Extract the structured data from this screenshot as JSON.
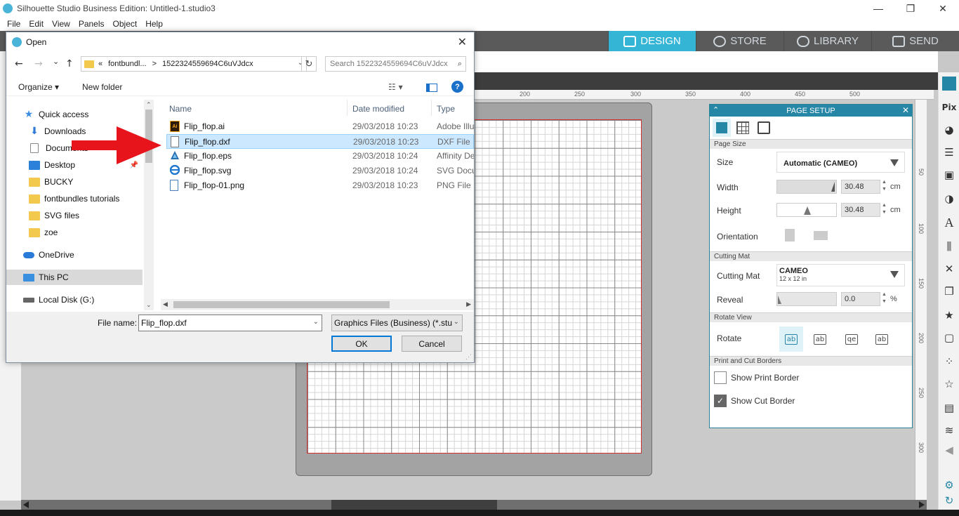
{
  "window": {
    "title": "Silhouette Studio Business Edition: Untitled-1.studio3",
    "minimize": "—",
    "restore": "❐",
    "close": "✕"
  },
  "menu": [
    "File",
    "Edit",
    "View",
    "Panels",
    "Object",
    "Help"
  ],
  "nav_tabs": [
    {
      "label": "DESIGN",
      "active": true
    },
    {
      "label": "STORE",
      "active": false
    },
    {
      "label": "LIBRARY",
      "active": false
    },
    {
      "label": "SEND",
      "active": false
    }
  ],
  "ruler": {
    "top": [
      "200",
      "250",
      "300",
      "350",
      "400",
      "450",
      "500"
    ],
    "right": [
      "50",
      "100",
      "150",
      "200",
      "250",
      "300"
    ]
  },
  "page_setup": {
    "title": "PAGE SETUP",
    "collapse": "⌃",
    "close": "✕",
    "sections": {
      "page_size": "Page Size",
      "cutting_mat": "Cutting Mat",
      "rotate_view": "Rotate View",
      "borders": "Print and Cut Borders"
    },
    "size_label": "Size",
    "size_value": "Automatic (CAMEO)",
    "width_label": "Width",
    "width_value": "30.48",
    "height_label": "Height",
    "height_value": "30.48",
    "unit": "cm",
    "orientation_label": "Orientation",
    "mat_label": "Cutting Mat",
    "mat_value": "CAMEO",
    "mat_sub": "12 x 12 in",
    "reveal_label": "Reveal",
    "reveal_value": "0.0",
    "reveal_unit": "%",
    "rotate_label": "Rotate",
    "rotate_glyphs": [
      "ab",
      "ab",
      "qe",
      "ab"
    ],
    "show_print_border": "Show Print Border",
    "show_cut_border": "Show Cut Border",
    "print_border_checked": false,
    "cut_border_checked": true
  },
  "dialog": {
    "title": "Open",
    "close": "✕",
    "back": "←",
    "forward": "→",
    "recent": "⌄",
    "up": "↑",
    "address": [
      "«",
      "fontbundl...",
      ">",
      "1522324559694C6uVJdcx"
    ],
    "refresh": "↻",
    "search_placeholder": "Search 1522324559694C6uVJdcx",
    "search_icon": "⌕",
    "organize": "Organize ▾",
    "new_folder": "New folder",
    "help": "?",
    "nav_items": [
      {
        "label": "Quick access",
        "icon": "star"
      },
      {
        "label": "Downloads",
        "icon": "down"
      },
      {
        "label": "Documents",
        "icon": "doc"
      },
      {
        "label": "Desktop",
        "icon": "desktop"
      },
      {
        "label": "BUCKY",
        "icon": "folder"
      },
      {
        "label": "fontbundles tutorials",
        "icon": "folder"
      },
      {
        "label": "SVG files",
        "icon": "folder"
      },
      {
        "label": "zoe",
        "icon": "folder"
      },
      {
        "label": "OneDrive",
        "icon": "cloud"
      },
      {
        "label": "This PC",
        "icon": "pc"
      },
      {
        "label": "Local Disk (G:)",
        "icon": "disk"
      }
    ],
    "columns": {
      "name": "Name",
      "date": "Date modified",
      "type": "Type"
    },
    "files": [
      {
        "name": "Flip_flop.ai",
        "date": "29/03/2018 10:23",
        "type": "Adobe Illu",
        "icon": "ai"
      },
      {
        "name": "Flip_flop.dxf",
        "date": "29/03/2018 10:23",
        "type": "DXF File",
        "icon": "dxf",
        "selected": true
      },
      {
        "name": "Flip_flop.eps",
        "date": "29/03/2018 10:24",
        "type": "Affinity De",
        "icon": "eps"
      },
      {
        "name": "Flip_flop.svg",
        "date": "29/03/2018 10:24",
        "type": "SVG Docu",
        "icon": "svg"
      },
      {
        "name": "Flip_flop-01.png",
        "date": "29/03/2018 10:23",
        "type": "PNG File",
        "icon": "png"
      }
    ],
    "filename_label": "File name:",
    "filename_value": "Flip_flop.dxf",
    "filetype_value": "Graphics Files (Business) (*.stuc",
    "ok": "OK",
    "cancel": "Cancel"
  },
  "colors": {
    "accent": "#34b5d6",
    "panel_header": "#2686a6",
    "arrow": "#e8141b"
  }
}
